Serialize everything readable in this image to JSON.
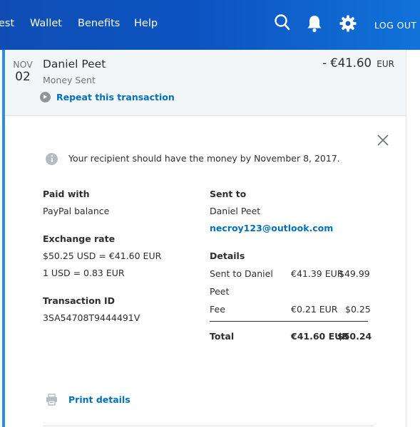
{
  "nav": {
    "items": [
      "est",
      "Wallet",
      "Benefits",
      "Help"
    ],
    "logout": "LOG OUT",
    "icons": [
      "search-icon",
      "bell-icon",
      "gear-icon"
    ]
  },
  "transaction": {
    "month": "NOV",
    "day": "02",
    "name": "Daniel Peet",
    "type": "Money Sent",
    "amount": "- €41.60",
    "currency": "EUR",
    "repeat_label": "Repeat this transaction"
  },
  "details": {
    "info_text": "Your recipient should have the money by November 8, 2017.",
    "paid_with_label": "Paid with",
    "paid_with_value": "PayPal balance",
    "exchange_rate_label": "Exchange rate",
    "exchange_rate_line1": "$50.25 USD = €41.60 EUR",
    "exchange_rate_line2": "1 USD = 0.83 EUR",
    "transaction_id_label": "Transaction ID",
    "transaction_id_value": "3SA54708T9444491V",
    "sent_to_label": "Sent to",
    "sent_to_name": "Daniel Peet",
    "sent_to_email": "necroy123@outlook.com",
    "details_label": "Details",
    "rows": [
      {
        "desc_line1": "Sent to Daniel",
        "desc_line2": "Peet",
        "eur": "€41.39 EUR",
        "usd": "$49.99"
      },
      {
        "desc_line1": "Fee",
        "desc_line2": "",
        "eur": "€0.21 EUR",
        "usd": "$0.25"
      }
    ],
    "total_label": "Total",
    "total_eur": "€41.60 EUR",
    "total_usd": "$50.24",
    "print_label": "Print details"
  },
  "colors": {
    "nav_bg": "#0d55c2",
    "link": "#0070ba",
    "accent_stripe": "#2d8fe4"
  }
}
